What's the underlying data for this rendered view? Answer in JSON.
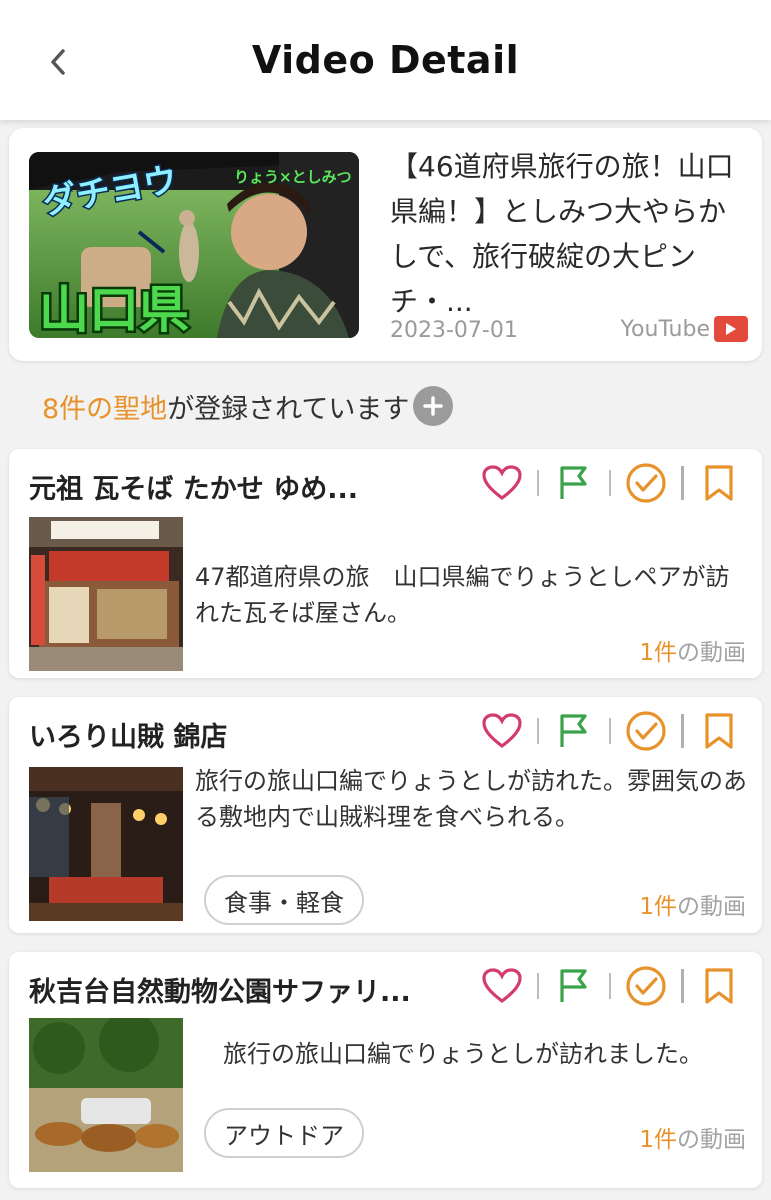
{
  "header": {
    "title": "Video Detail",
    "back_icon": "chevron-left-icon"
  },
  "video": {
    "title": "【46道府県旅行の旅！山口県編！】としみつ大やらかしで、旅行破綻の大ピンチ・...",
    "date": "2023-07-01",
    "source_label": "YouTube",
    "thumbnail_caption_top": "りょう×としみつ",
    "thumbnail_caption_left": "ダチヨウ",
    "thumbnail_caption_main": "山口県"
  },
  "registered": {
    "count_prefix": "8件の聖地",
    "count_suffix": "が登録されています",
    "add_icon": "plus-circle-icon"
  },
  "colors": {
    "accent": "#e8922b",
    "heart": "#d23c6e",
    "flag": "#3aa34a",
    "check": "#e8922b",
    "bookmark": "#e8922b",
    "youtube": "#e44a3c"
  },
  "spots": [
    {
      "name": "元祖 瓦そば たかせ ゆめ...",
      "description": "47都道府県の旅　山口県編でりょうとしペアが訪れた瓦そば屋さん。",
      "video_count_num": "1件",
      "video_count_suffix": "の動画",
      "tag": ""
    },
    {
      "name": "いろり山賊 錦店",
      "description": "旅行の旅山口編でりょうとしが訪れた。雰囲気のある敷地内で山賊料理を食べられる。",
      "video_count_num": "1件",
      "video_count_suffix": "の動画",
      "tag": "食事・軽食"
    },
    {
      "name": "秋吉台自然動物公園サファリ...",
      "description": "旅行の旅山口編でりょうとしが訪れました。",
      "video_count_num": "1件",
      "video_count_suffix": "の動画",
      "tag": "アウトドア"
    }
  ]
}
